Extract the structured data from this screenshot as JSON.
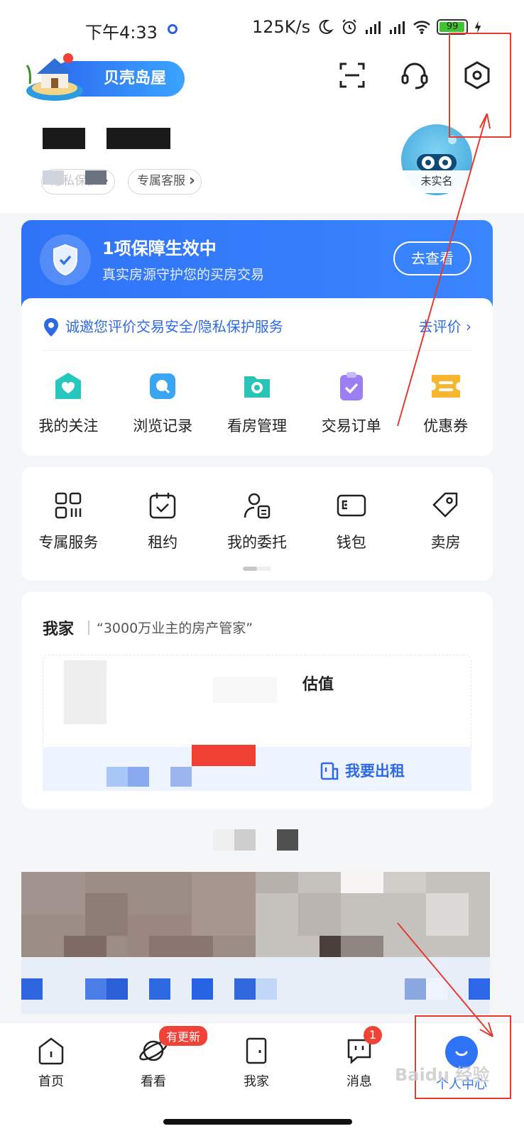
{
  "status_bar": {
    "time": "下午4:33",
    "net_speed": "125K/s",
    "battery": "99"
  },
  "header": {
    "app_name": "贝壳岛屋",
    "chips": [
      "隐私保护",
      "专属客服"
    ],
    "avatar_label": "未实名"
  },
  "protection": {
    "title": "1项保障生效中",
    "subtitle": "真实房源守护您的买房交易",
    "button": "去查看"
  },
  "evaluation": {
    "text": "诚邀您评价交易安全/隐私保护服务",
    "link": "去评价"
  },
  "grid_primary": [
    {
      "label": "我的关注",
      "icon": "heart-house-icon",
      "color": "#27c7c0"
    },
    {
      "label": "浏览记录",
      "icon": "chat-bubble-icon",
      "color": "#3aa5f2"
    },
    {
      "label": "看房管理",
      "icon": "folder-icon",
      "color": "#28c4b6"
    },
    {
      "label": "交易订单",
      "icon": "clipboard-check-icon",
      "color": "#9b7ff2"
    },
    {
      "label": "优惠券",
      "icon": "ticket-icon",
      "color": "#f6b72e"
    }
  ],
  "grid_secondary": [
    {
      "label": "专属服务",
      "icon": "apps-icon"
    },
    {
      "label": "租约",
      "icon": "calendar-check-icon"
    },
    {
      "label": "我的委托",
      "icon": "person-doc-icon"
    },
    {
      "label": "钱包",
      "icon": "wallet-icon"
    },
    {
      "label": "卖房",
      "icon": "tag-icon"
    }
  ],
  "my_home": {
    "title": "我家",
    "slogan": "“3000万业主的房产管家”",
    "estimate": "估值",
    "rent_link": "我要出租"
  },
  "tabbar": [
    {
      "label": "首页",
      "icon": "home-icon"
    },
    {
      "label": "看看",
      "icon": "planet-icon",
      "badge": "有更新"
    },
    {
      "label": "我家",
      "icon": "door-icon"
    },
    {
      "label": "消息",
      "icon": "message-icon",
      "badge": "1"
    },
    {
      "label": "个人中心",
      "icon": "smile-icon"
    }
  ],
  "watermark": "Baidu 经验",
  "colors": {
    "accent": "#2f73f7",
    "badge": "#f04236",
    "annotation": "#e53a2f"
  }
}
